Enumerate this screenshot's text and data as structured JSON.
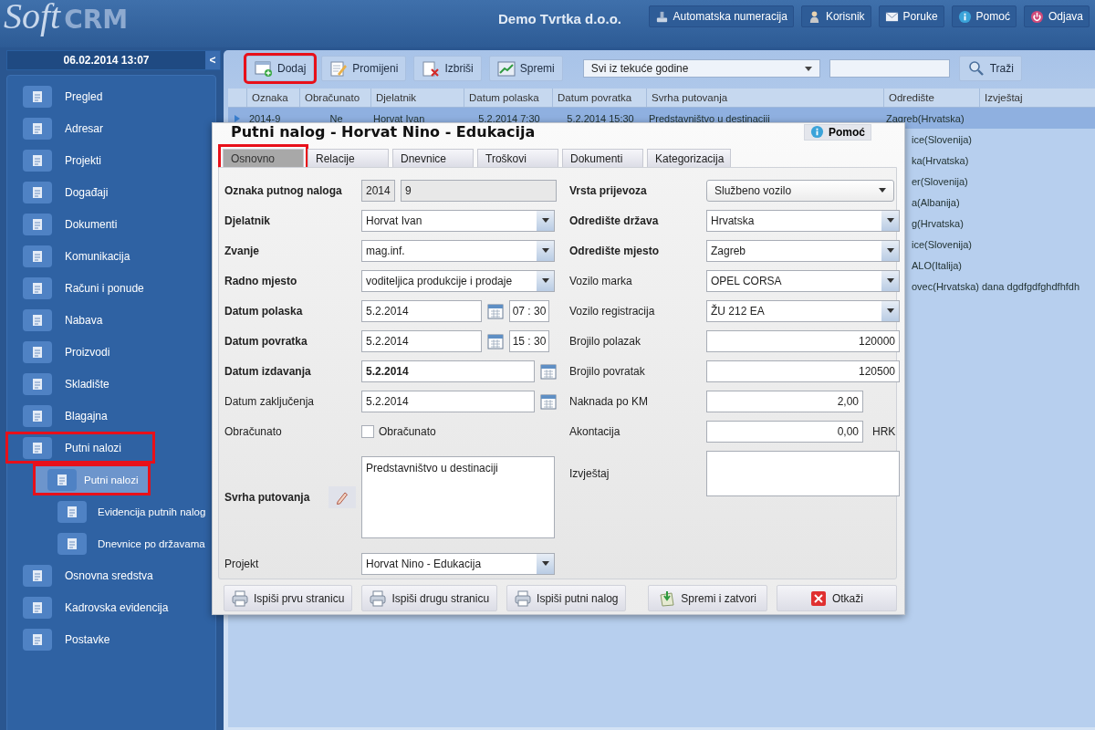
{
  "header": {
    "logo": {
      "script": "Soft",
      "bold": "CRM"
    },
    "company": "Demo Tvrtka d.o.o.",
    "buttons": [
      {
        "label": "Automatska numeracija",
        "kind": "stamp"
      },
      {
        "label": "Korisnik",
        "kind": "user"
      },
      {
        "label": "Poruke",
        "kind": "mail"
      },
      {
        "label": "Pomoć",
        "kind": "info"
      },
      {
        "label": "Odjava",
        "kind": "power"
      }
    ]
  },
  "sidebar": {
    "datetime": "06.02.2014 13:07",
    "collapse": "<",
    "items": [
      {
        "label": "Pregled",
        "selected": false,
        "highlighted": false
      },
      {
        "label": "Adresar",
        "selected": false,
        "highlighted": false
      },
      {
        "label": "Projekti",
        "selected": false,
        "highlighted": false
      },
      {
        "label": "Događaji",
        "selected": false,
        "highlighted": false
      },
      {
        "label": "Dokumenti",
        "selected": false,
        "highlighted": false
      },
      {
        "label": "Komunikacija",
        "selected": false,
        "highlighted": false
      },
      {
        "label": "Računi i ponude",
        "selected": false,
        "highlighted": false
      },
      {
        "label": "Nabava",
        "selected": false,
        "highlighted": false
      },
      {
        "label": "Proizvodi",
        "selected": false,
        "highlighted": false
      },
      {
        "label": "Skladište",
        "selected": false,
        "highlighted": false
      },
      {
        "label": "Blagajna",
        "selected": false,
        "highlighted": false
      },
      {
        "label": "Putni nalozi",
        "selected": false,
        "highlighted": true,
        "expanded": true,
        "children": [
          {
            "label": "Putni nalozi",
            "selected": true,
            "highlighted": true
          },
          {
            "label": "Evidencija putnih nalog",
            "selected": false,
            "highlighted": false
          },
          {
            "label": "Dnevnice po državama",
            "selected": false,
            "highlighted": false
          }
        ]
      },
      {
        "label": "Osnovna sredstva",
        "selected": false,
        "highlighted": false
      },
      {
        "label": "Kadrovska evidencija",
        "selected": false,
        "highlighted": false
      },
      {
        "label": "Postavke",
        "selected": false,
        "highlighted": false
      }
    ]
  },
  "toolbar": {
    "buttons": [
      {
        "label": "Dodaj",
        "kind": "add",
        "highlighted": true
      },
      {
        "label": "Promijeni",
        "kind": "edit",
        "highlighted": false
      },
      {
        "label": "Izbriši",
        "kind": "delete",
        "highlighted": false
      },
      {
        "label": "Spremi",
        "kind": "save",
        "highlighted": false
      }
    ],
    "filter": "Svi iz tekuće godine",
    "search_button": "Traži"
  },
  "table": {
    "columns": [
      "Oznaka",
      "Obračunato",
      "Djelatnik",
      "Datum polaska",
      "Datum povratka",
      "Svrha putovanja",
      "Odredište",
      "Izvještaj"
    ],
    "rows": [
      {
        "selected": true,
        "oznaka": "2014-9",
        "obracunato": "Ne",
        "djelatnik": "Horvat Ivan",
        "datum_polaska": "5.2.2014 7:30",
        "datum_povratka": "5.2.2014 15:30",
        "svrha_putovanja": "Predstavništvo u destinaciji",
        "odrediste": "Zagreb(Hrvatska)"
      },
      {
        "selected": false,
        "odrediste": "ice(Slovenija)"
      },
      {
        "selected": false,
        "odrediste": "ka(Hrvatska)"
      },
      {
        "selected": false,
        "odrediste": "er(Slovenija)"
      },
      {
        "selected": false,
        "odrediste": "a(Albanija)"
      },
      {
        "selected": false,
        "odrediste": "g(Hrvatska)"
      },
      {
        "selected": false,
        "odrediste": "ice(Slovenija)"
      },
      {
        "selected": false,
        "odrediste": "ALO(Italija)"
      },
      {
        "selected": false,
        "odrediste": "ovec(Hrvatska)",
        "izvjestaj": "dana dgdfgdfghdfhfdh"
      }
    ]
  },
  "dialog": {
    "title": "Putni nalog - Horvat Nino - Edukacija",
    "help": "Pomoć",
    "tabs": [
      {
        "label": "Osnovno",
        "selected": true,
        "highlighted": true
      },
      {
        "label": "Relacije",
        "selected": false,
        "highlighted": false
      },
      {
        "label": "Dnevnice",
        "selected": false,
        "highlighted": false
      },
      {
        "label": "Troškovi",
        "selected": false,
        "highlighted": false
      },
      {
        "label": "Dokumenti",
        "selected": false,
        "highlighted": false
      },
      {
        "label": "Kategorizacija",
        "selected": false,
        "highlighted": false
      }
    ],
    "left": [
      {
        "kind": "code",
        "label": "Oznaka putnog naloga",
        "bold": true,
        "values": [
          "2014",
          "9"
        ]
      },
      {
        "kind": "select",
        "label": "Djelatnik",
        "bold": true,
        "value": "Horvat Ivan"
      },
      {
        "kind": "select",
        "label": "Zvanje",
        "bold": true,
        "value": "mag.inf."
      },
      {
        "kind": "select",
        "label": "Radno mjesto",
        "bold": true,
        "value": "voditeljica produkcije i prodaje"
      },
      {
        "kind": "datetime",
        "label": "Datum polaska",
        "bold": true,
        "value": "5.2.2014",
        "time": "07 : 30"
      },
      {
        "kind": "datetime",
        "label": "Datum povratka",
        "bold": true,
        "value": "5.2.2014",
        "time": "15 : 30"
      },
      {
        "kind": "date",
        "label": "Datum izdavanja",
        "bold": true,
        "value": "5.2.2014",
        "value_bold": true
      },
      {
        "kind": "date",
        "label": "Datum zaključenja",
        "bold": false,
        "value": "5.2.2014",
        "value_bold": false
      },
      {
        "kind": "checkbox",
        "label": "Obračunato",
        "bold": false,
        "text": "Obračunato",
        "checked": false
      },
      {
        "kind": "textarea",
        "label": "Svrha putovanja",
        "bold": true,
        "value": "Predstavništvo u destinaciji",
        "edit_button": true
      },
      {
        "kind": "select",
        "label": "Projekt",
        "bold": false,
        "value": "Horvat Nino - Edukacija"
      }
    ],
    "right": [
      {
        "kind": "combo",
        "label": "Vrsta prijevoza",
        "bold": true,
        "value": "Službeno vozilo"
      },
      {
        "kind": "select",
        "label": "Odredište država",
        "bold": true,
        "value": "Hrvatska"
      },
      {
        "kind": "select",
        "label": "Odredište mjesto",
        "bold": true,
        "value": "Zagreb"
      },
      {
        "kind": "select",
        "label": "Vozilo marka",
        "bold": false,
        "value": "OPEL CORSA"
      },
      {
        "kind": "select",
        "label": "Vozilo registracija",
        "bold": false,
        "value": "ŽU 212 EA"
      },
      {
        "kind": "number",
        "label": "Brojilo polazak",
        "bold": false,
        "value": "120000",
        "narrow": false
      },
      {
        "kind": "number",
        "label": "Brojilo povratak",
        "bold": false,
        "value": "120500",
        "narrow": false
      },
      {
        "kind": "number",
        "label": "Naknada po KM",
        "bold": false,
        "value": "2,00",
        "narrow": true
      },
      {
        "kind": "number",
        "label": "Akontacija",
        "bold": false,
        "value": "0,00",
        "narrow": true,
        "unit": "HRK"
      },
      {
        "kind": "textarea",
        "label": "Izvještaj",
        "bold": false,
        "edit_button": false
      }
    ],
    "buttons": [
      {
        "label": "Ispiši prvu stranicu",
        "kind": "print"
      },
      {
        "label": "Ispiši drugu stranicu",
        "kind": "print"
      },
      {
        "label": "Ispiši putni nalog",
        "kind": "print"
      },
      {
        "label": "Spremi i zatvori",
        "kind": "save"
      },
      {
        "label": "Otkaži",
        "kind": "cancel"
      }
    ]
  }
}
